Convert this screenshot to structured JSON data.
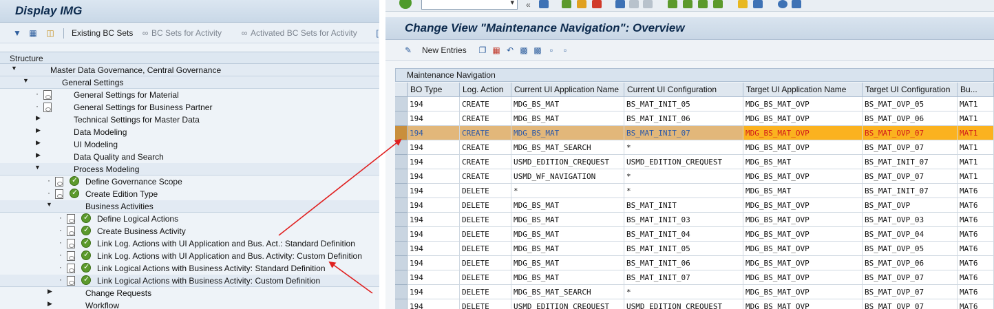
{
  "left": {
    "title": "Display IMG",
    "toolbar": {
      "existing_bc_sets": "Existing BC Sets",
      "bc_sets_activity": "BC Sets for Activity",
      "activated_bc_sets": "Activated BC Sets for Activity"
    },
    "tree_header": "Structure",
    "tree": [
      {
        "label": "Master Data Governance, Central Governance"
      },
      {
        "label": "General Settings"
      },
      {
        "label": "General Settings for Material"
      },
      {
        "label": "General Settings for Business Partner"
      },
      {
        "label": "Technical Settings for Master Data"
      },
      {
        "label": "Data Modeling"
      },
      {
        "label": "UI Modeling"
      },
      {
        "label": "Data Quality and Search"
      },
      {
        "label": "Process Modeling"
      },
      {
        "label": "Define Governance Scope"
      },
      {
        "label": "Create Edition Type"
      },
      {
        "label": "Business Activities"
      },
      {
        "label": "Define Logical Actions"
      },
      {
        "label": "Create Business Activity"
      },
      {
        "label": "Link Log. Actions with UI Application and Bus. Act.: Standard Definition"
      },
      {
        "label": "Link Log. Actions with UI Application and Bus. Activity: Custom Definition"
      },
      {
        "label": "Link Logical Actions with Business Activity: Standard Definition"
      },
      {
        "label": "Link Logical Actions with Business Activity: Custom Definition"
      },
      {
        "label": "Change Requests"
      },
      {
        "label": "Workflow"
      }
    ]
  },
  "right": {
    "title": "Change View \"Maintenance Navigation\": Overview",
    "toolbar": {
      "new_entries": "New Entries"
    },
    "table_caption": "Maintenance Navigation",
    "columns": [
      "BO Type",
      "Log. Action",
      "Current UI Application Name",
      "Current UI Configuration",
      "Target UI Application Name",
      "Target UI Configuration",
      "Bu..."
    ],
    "rows": [
      [
        "194",
        "CREATE",
        "MDG_BS_MAT",
        "BS_MAT_INIT_05",
        "MDG_BS_MAT_OVP",
        "BS_MAT_OVP_05",
        "MAT1"
      ],
      [
        "194",
        "CREATE",
        "MDG_BS_MAT",
        "BS_MAT_INIT_06",
        "MDG_BS_MAT_OVP",
        "BS_MAT_OVP_06",
        "MAT1"
      ],
      [
        "194",
        "CREATE",
        "MDG_BS_MAT",
        "BS_MAT_INIT_07",
        "MDG_BS_MAT_OVP",
        "BS_MAT_OVP_07",
        "MAT1"
      ],
      [
        "194",
        "CREATE",
        "MDG_BS_MAT_SEARCH",
        "*",
        "MDG_BS_MAT_OVP",
        "BS_MAT_OVP_07",
        "MAT1"
      ],
      [
        "194",
        "CREATE",
        "USMD_EDITION_CREQUEST",
        "USMD_EDITION_CREQUEST",
        "MDG_BS_MAT",
        "BS_MAT_INIT_07",
        "MAT1"
      ],
      [
        "194",
        "CREATE",
        "USMD_WF_NAVIGATION",
        "*",
        "MDG_BS_MAT_OVP",
        "BS_MAT_OVP_07",
        "MAT1"
      ],
      [
        "194",
        "DELETE",
        "*",
        "*",
        "MDG_BS_MAT",
        "BS_MAT_INIT_07",
        "MAT6"
      ],
      [
        "194",
        "DELETE",
        "MDG_BS_MAT",
        "BS_MAT_INIT",
        "MDG_BS_MAT_OVP",
        "BS_MAT_OVP",
        "MAT6"
      ],
      [
        "194",
        "DELETE",
        "MDG_BS_MAT",
        "BS_MAT_INIT_03",
        "MDG_BS_MAT_OVP",
        "BS_MAT_OVP_03",
        "MAT6"
      ],
      [
        "194",
        "DELETE",
        "MDG_BS_MAT",
        "BS_MAT_INIT_04",
        "MDG_BS_MAT_OVP",
        "BS_MAT_OVP_04",
        "MAT6"
      ],
      [
        "194",
        "DELETE",
        "MDG_BS_MAT",
        "BS_MAT_INIT_05",
        "MDG_BS_MAT_OVP",
        "BS_MAT_OVP_05",
        "MAT6"
      ],
      [
        "194",
        "DELETE",
        "MDG_BS_MAT",
        "BS_MAT_INIT_06",
        "MDG_BS_MAT_OVP",
        "BS_MAT_OVP_06",
        "MAT6"
      ],
      [
        "194",
        "DELETE",
        "MDG_BS_MAT",
        "BS_MAT_INIT_07",
        "MDG_BS_MAT_OVP",
        "BS_MAT_OVP_07",
        "MAT6"
      ],
      [
        "194",
        "DELETE",
        "MDG_BS_MAT_SEARCH",
        "*",
        "MDG_BS_MAT_OVP",
        "BS_MAT_OVP_07",
        "MAT6"
      ],
      [
        "194",
        "DELETE",
        "USMD_EDITION_CREQUEST",
        "USMD_EDITION_CREQUEST",
        "MDG_BS_MAT_OVP",
        "BS_MAT_OVP_07",
        "MAT6"
      ]
    ]
  },
  "colors": {
    "highlight_row": "#e2b77a",
    "highlight_orange": "#fbb21f",
    "annotation_arrow": "#e02020"
  }
}
